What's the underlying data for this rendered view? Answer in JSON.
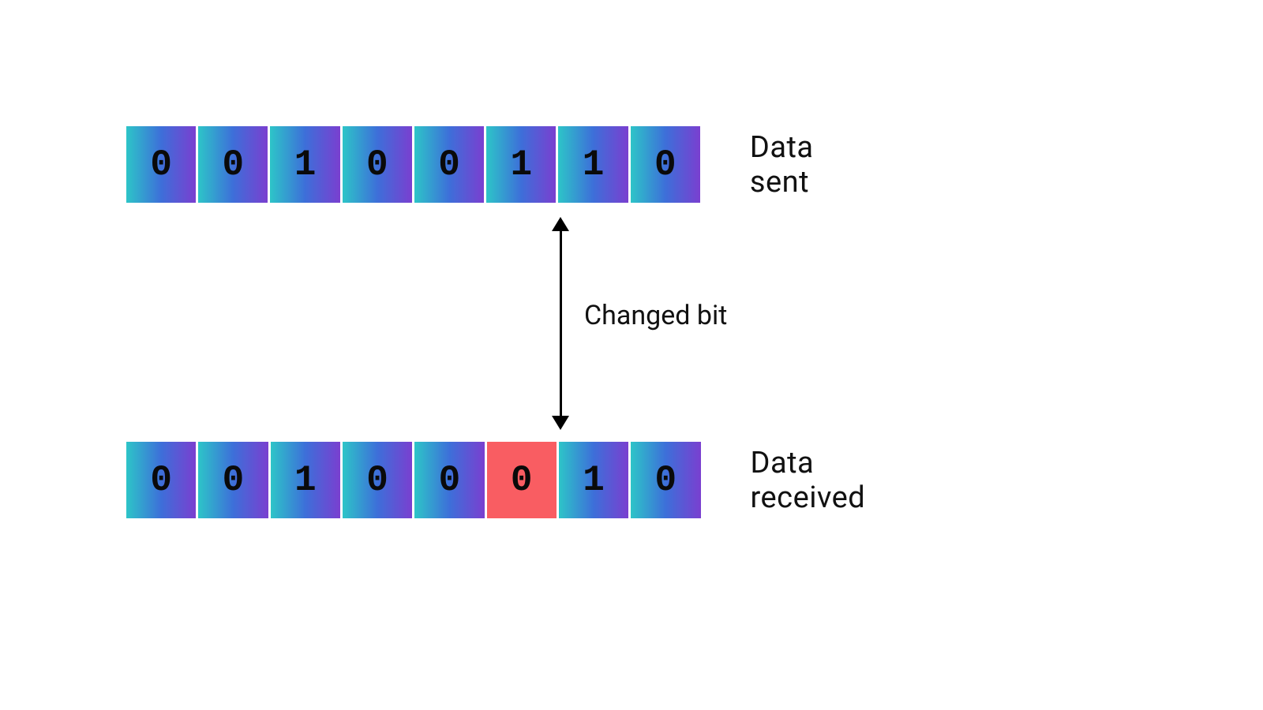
{
  "labels": {
    "sent": "Data sent",
    "received": "Data  received",
    "changed": "Changed bit"
  },
  "rows": {
    "sent": [
      "0",
      "0",
      "1",
      "0",
      "0",
      "1",
      "1",
      "0"
    ],
    "received": [
      "0",
      "0",
      "1",
      "0",
      "0",
      "0",
      "1",
      "0"
    ]
  },
  "changed_index": 5,
  "colors": {
    "bit_gradient_start": "#2dc5c8",
    "bit_gradient_mid": "#3d6fd9",
    "bit_gradient_end": "#7a3fd0",
    "error": "#f95d62"
  }
}
